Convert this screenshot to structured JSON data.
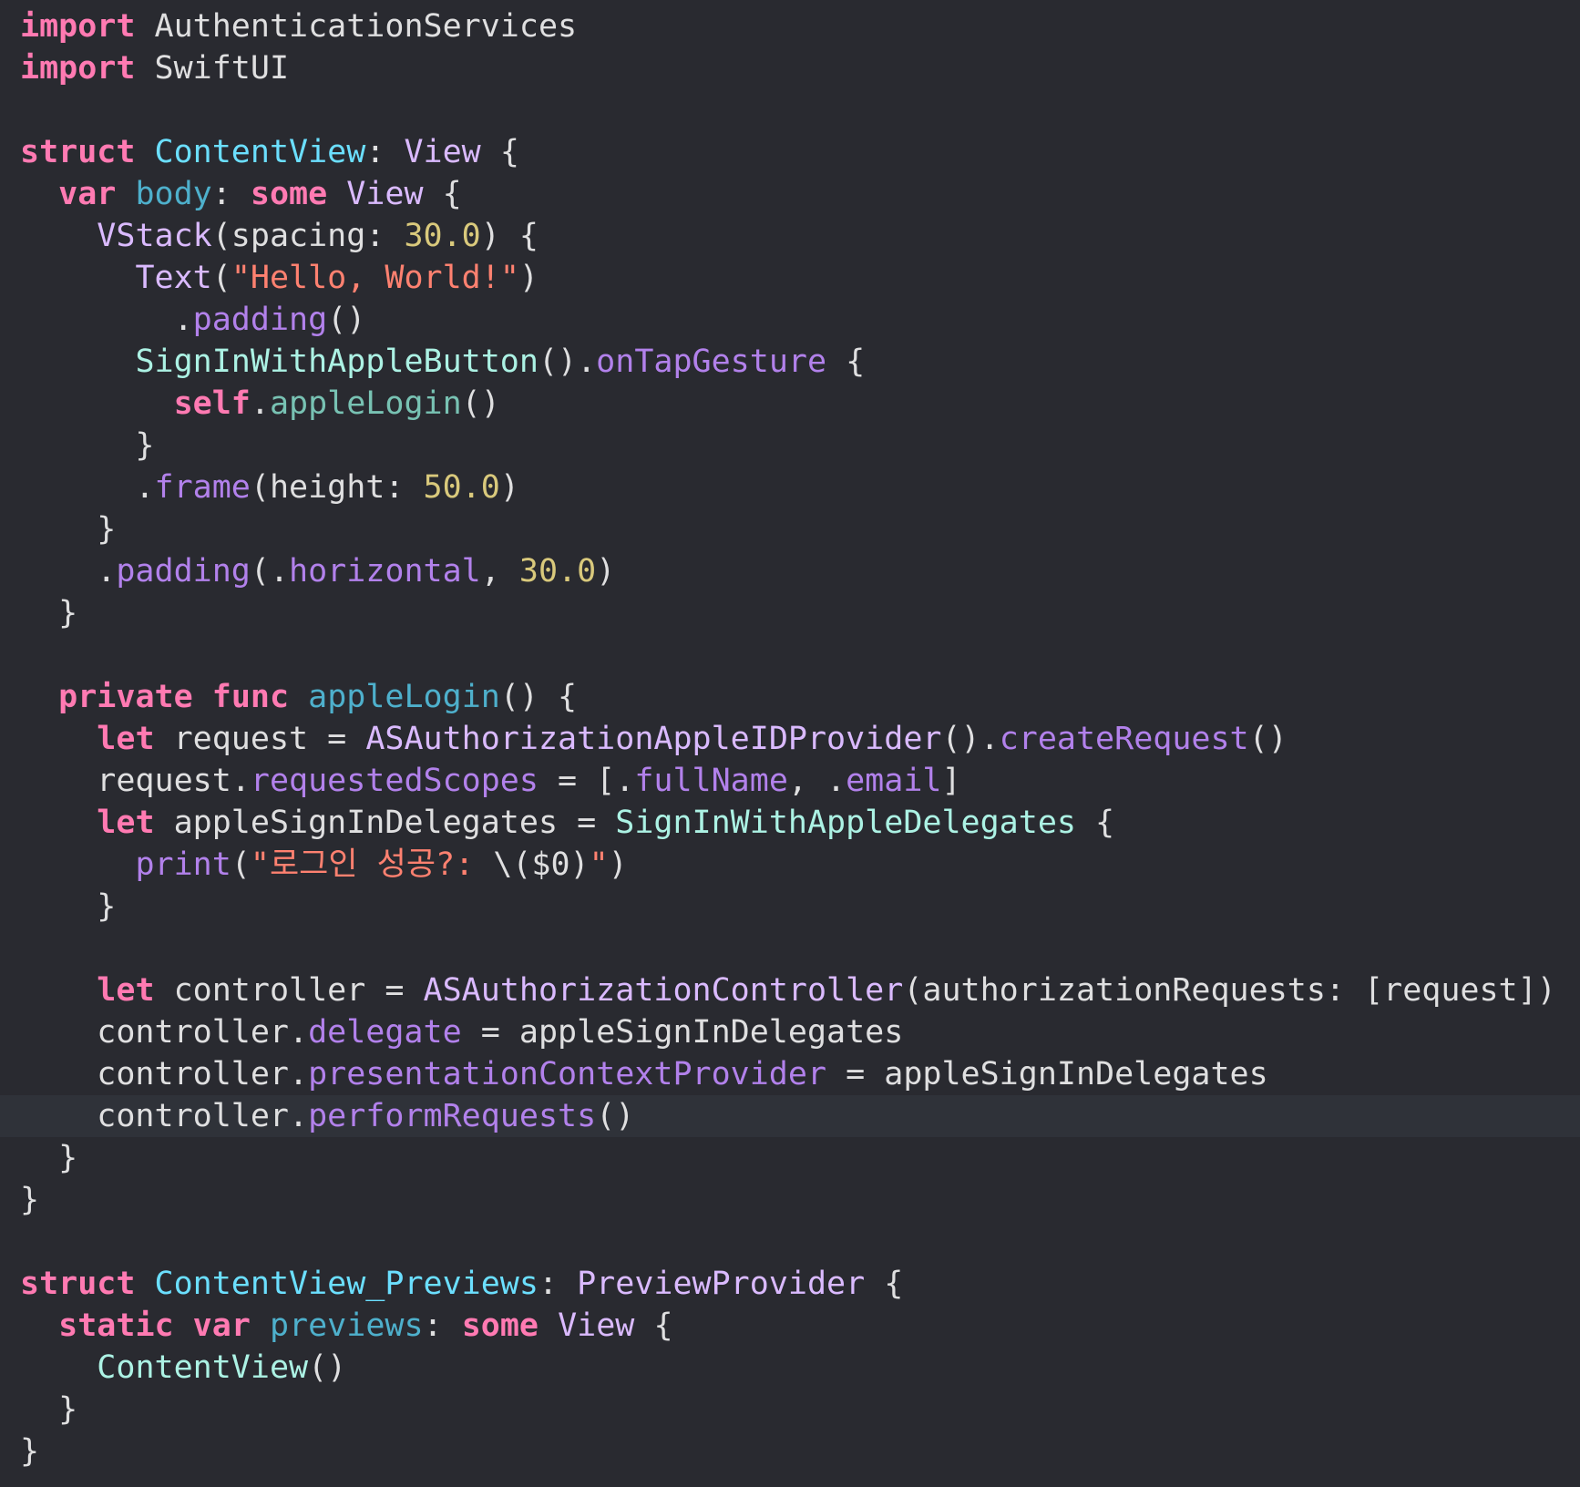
{
  "editor": {
    "theme": {
      "background": "#292a30",
      "current_line": "#2f3239",
      "keyword": "#ff7ab2",
      "declaration": "#6bdfff",
      "type": "#dabaff",
      "other_member": "#b281eb",
      "project_member": "#78c2b3",
      "class": "#acf2e4",
      "string": "#ff8170",
      "number": "#d9c97c",
      "plain": "#dfdfe0"
    },
    "current_line_index": 26,
    "lines": [
      [
        {
          "t": "import",
          "c": "kw"
        },
        {
          "t": " AuthenticationServices",
          "c": "plain"
        }
      ],
      [
        {
          "t": "import",
          "c": "kw"
        },
        {
          "t": " SwiftUI",
          "c": "plain"
        }
      ],
      [],
      [
        {
          "t": "struct",
          "c": "kw"
        },
        {
          "t": " ",
          "c": "plain"
        },
        {
          "t": "ContentView",
          "c": "decl"
        },
        {
          "t": ": ",
          "c": "plain"
        },
        {
          "t": "View",
          "c": "type"
        },
        {
          "t": " {",
          "c": "plain"
        }
      ],
      [
        {
          "t": "  ",
          "c": "plain"
        },
        {
          "t": "var",
          "c": "kw"
        },
        {
          "t": " ",
          "c": "plain"
        },
        {
          "t": "body",
          "c": "vdecl"
        },
        {
          "t": ": ",
          "c": "plain"
        },
        {
          "t": "some",
          "c": "kw"
        },
        {
          "t": " ",
          "c": "plain"
        },
        {
          "t": "View",
          "c": "type"
        },
        {
          "t": " {",
          "c": "plain"
        }
      ],
      [
        {
          "t": "    ",
          "c": "plain"
        },
        {
          "t": "VStack",
          "c": "type"
        },
        {
          "t": "(spacing: ",
          "c": "plain"
        },
        {
          "t": "30.0",
          "c": "num"
        },
        {
          "t": ") {",
          "c": "plain"
        }
      ],
      [
        {
          "t": "      ",
          "c": "plain"
        },
        {
          "t": "Text",
          "c": "type"
        },
        {
          "t": "(",
          "c": "plain"
        },
        {
          "t": "\"Hello, World!\"",
          "c": "str"
        },
        {
          "t": ")",
          "c": "plain"
        }
      ],
      [
        {
          "t": "        .",
          "c": "plain"
        },
        {
          "t": "padding",
          "c": "other"
        },
        {
          "t": "()",
          "c": "plain"
        }
      ],
      [
        {
          "t": "      ",
          "c": "plain"
        },
        {
          "t": "SignInWithAppleButton",
          "c": "cls"
        },
        {
          "t": "().",
          "c": "plain"
        },
        {
          "t": "onTapGesture",
          "c": "other"
        },
        {
          "t": " {",
          "c": "plain"
        }
      ],
      [
        {
          "t": "        ",
          "c": "plain"
        },
        {
          "t": "self",
          "c": "kw"
        },
        {
          "t": ".",
          "c": "plain"
        },
        {
          "t": "appleLogin",
          "c": "proj"
        },
        {
          "t": "()",
          "c": "plain"
        }
      ],
      [
        {
          "t": "      }",
          "c": "plain"
        }
      ],
      [
        {
          "t": "      .",
          "c": "plain"
        },
        {
          "t": "frame",
          "c": "other"
        },
        {
          "t": "(height: ",
          "c": "plain"
        },
        {
          "t": "50.0",
          "c": "num"
        },
        {
          "t": ")",
          "c": "plain"
        }
      ],
      [
        {
          "t": "    }",
          "c": "plain"
        }
      ],
      [
        {
          "t": "    .",
          "c": "plain"
        },
        {
          "t": "padding",
          "c": "other"
        },
        {
          "t": "(.",
          "c": "plain"
        },
        {
          "t": "horizontal",
          "c": "other"
        },
        {
          "t": ", ",
          "c": "plain"
        },
        {
          "t": "30.0",
          "c": "num"
        },
        {
          "t": ")",
          "c": "plain"
        }
      ],
      [
        {
          "t": "  }",
          "c": "plain"
        }
      ],
      [],
      [
        {
          "t": "  ",
          "c": "plain"
        },
        {
          "t": "private",
          "c": "kw"
        },
        {
          "t": " ",
          "c": "plain"
        },
        {
          "t": "func",
          "c": "kw"
        },
        {
          "t": " ",
          "c": "plain"
        },
        {
          "t": "appleLogin",
          "c": "vdecl"
        },
        {
          "t": "() {",
          "c": "plain"
        }
      ],
      [
        {
          "t": "    ",
          "c": "plain"
        },
        {
          "t": "let",
          "c": "kw"
        },
        {
          "t": " request = ",
          "c": "plain"
        },
        {
          "t": "ASAuthorizationAppleIDProvider",
          "c": "type"
        },
        {
          "t": "().",
          "c": "plain"
        },
        {
          "t": "createRequest",
          "c": "other"
        },
        {
          "t": "()",
          "c": "plain"
        }
      ],
      [
        {
          "t": "    request.",
          "c": "plain"
        },
        {
          "t": "requestedScopes",
          "c": "other"
        },
        {
          "t": " = [.",
          "c": "plain"
        },
        {
          "t": "fullName",
          "c": "other"
        },
        {
          "t": ", .",
          "c": "plain"
        },
        {
          "t": "email",
          "c": "other"
        },
        {
          "t": "]",
          "c": "plain"
        }
      ],
      [
        {
          "t": "    ",
          "c": "plain"
        },
        {
          "t": "let",
          "c": "kw"
        },
        {
          "t": " appleSignInDelegates = ",
          "c": "plain"
        },
        {
          "t": "SignInWithAppleDelegates",
          "c": "cls"
        },
        {
          "t": " {",
          "c": "plain"
        }
      ],
      [
        {
          "t": "      ",
          "c": "plain"
        },
        {
          "t": "print",
          "c": "other"
        },
        {
          "t": "(",
          "c": "plain"
        },
        {
          "t": "\"로그인 성공?: ",
          "c": "str"
        },
        {
          "t": "\\($0)",
          "c": "plain"
        },
        {
          "t": "\"",
          "c": "str"
        },
        {
          "t": ")",
          "c": "plain"
        }
      ],
      [
        {
          "t": "    }",
          "c": "plain"
        }
      ],
      [],
      [
        {
          "t": "    ",
          "c": "plain"
        },
        {
          "t": "let",
          "c": "kw"
        },
        {
          "t": " controller = ",
          "c": "plain"
        },
        {
          "t": "ASAuthorizationController",
          "c": "type"
        },
        {
          "t": "(authorizationRequests: [request])",
          "c": "plain"
        }
      ],
      [
        {
          "t": "    controller.",
          "c": "plain"
        },
        {
          "t": "delegate",
          "c": "other"
        },
        {
          "t": " = appleSignInDelegates",
          "c": "plain"
        }
      ],
      [
        {
          "t": "    controller.",
          "c": "plain"
        },
        {
          "t": "presentationContextProvider",
          "c": "other"
        },
        {
          "t": " = appleSignInDelegates",
          "c": "plain"
        }
      ],
      [
        {
          "t": "    controller.",
          "c": "plain"
        },
        {
          "t": "performRequests",
          "c": "other"
        },
        {
          "t": "()",
          "c": "plain"
        }
      ],
      [
        {
          "t": "  }",
          "c": "plain"
        }
      ],
      [
        {
          "t": "}",
          "c": "plain"
        }
      ],
      [],
      [
        {
          "t": "struct",
          "c": "kw"
        },
        {
          "t": " ",
          "c": "plain"
        },
        {
          "t": "ContentView_Previews",
          "c": "decl"
        },
        {
          "t": ": ",
          "c": "plain"
        },
        {
          "t": "PreviewProvider",
          "c": "type"
        },
        {
          "t": " {",
          "c": "plain"
        }
      ],
      [
        {
          "t": "  ",
          "c": "plain"
        },
        {
          "t": "static",
          "c": "kw"
        },
        {
          "t": " ",
          "c": "plain"
        },
        {
          "t": "var",
          "c": "kw"
        },
        {
          "t": " ",
          "c": "plain"
        },
        {
          "t": "previews",
          "c": "vdecl"
        },
        {
          "t": ": ",
          "c": "plain"
        },
        {
          "t": "some",
          "c": "kw"
        },
        {
          "t": " ",
          "c": "plain"
        },
        {
          "t": "View",
          "c": "type"
        },
        {
          "t": " {",
          "c": "plain"
        }
      ],
      [
        {
          "t": "    ",
          "c": "plain"
        },
        {
          "t": "ContentView",
          "c": "cls"
        },
        {
          "t": "()",
          "c": "plain"
        }
      ],
      [
        {
          "t": "  }",
          "c": "plain"
        }
      ],
      [
        {
          "t": "}",
          "c": "plain"
        }
      ]
    ]
  }
}
